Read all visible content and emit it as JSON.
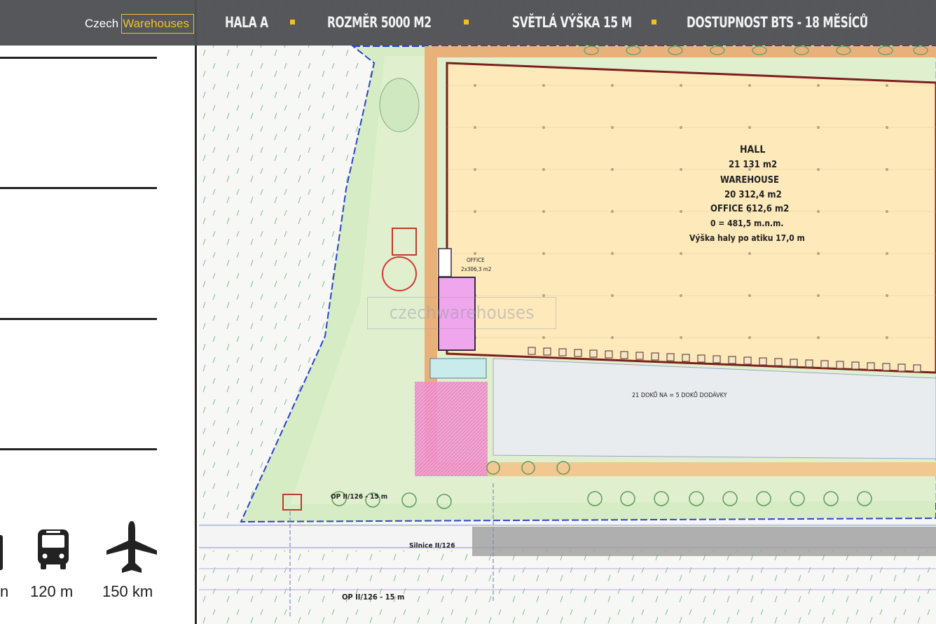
{
  "brand": {
    "part1": "Czech",
    "part2": "Warehouses",
    "accent_color": "#f1c21b"
  },
  "nav": {
    "items": [
      {
        "label": "HALA A"
      },
      {
        "label": "ROZMĚR 5000 M2"
      },
      {
        "label": "SVĚTLÁ VÝŠKA  15 M"
      },
      {
        "label": "DOSTUPNOST BTS - 18 MĚSÍCŮ"
      }
    ]
  },
  "distances": {
    "partial": {
      "label": "n",
      "icon": "partial-icon"
    },
    "bus": {
      "label": "120 m",
      "icon": "bus-icon"
    },
    "airport": {
      "label": "150 km",
      "icon": "airplane-icon"
    }
  },
  "plan": {
    "hall_title": "HALL",
    "hall_area": "21 131 m2",
    "warehouse_title": "WAREHOUSE",
    "warehouse_area": "20 312,4 m2",
    "office_area": "OFFICE 612,6 m2",
    "elevation": "0 = 481,5 m.n.m.",
    "height_note": "Výška haly po atiku 17,0 m",
    "office_small_title": "OFFICE",
    "office_small_area": "2x306,3 m2",
    "docks": "21 DOKŮ NA = 5 DOKŮ DODÁVKY",
    "road_name": "Silnice II/126",
    "protection_zone_1": "OP II/126 - 15 m",
    "protection_zone_2": "OP II/126 - 15 m",
    "watermark": "czechwarehouses"
  }
}
